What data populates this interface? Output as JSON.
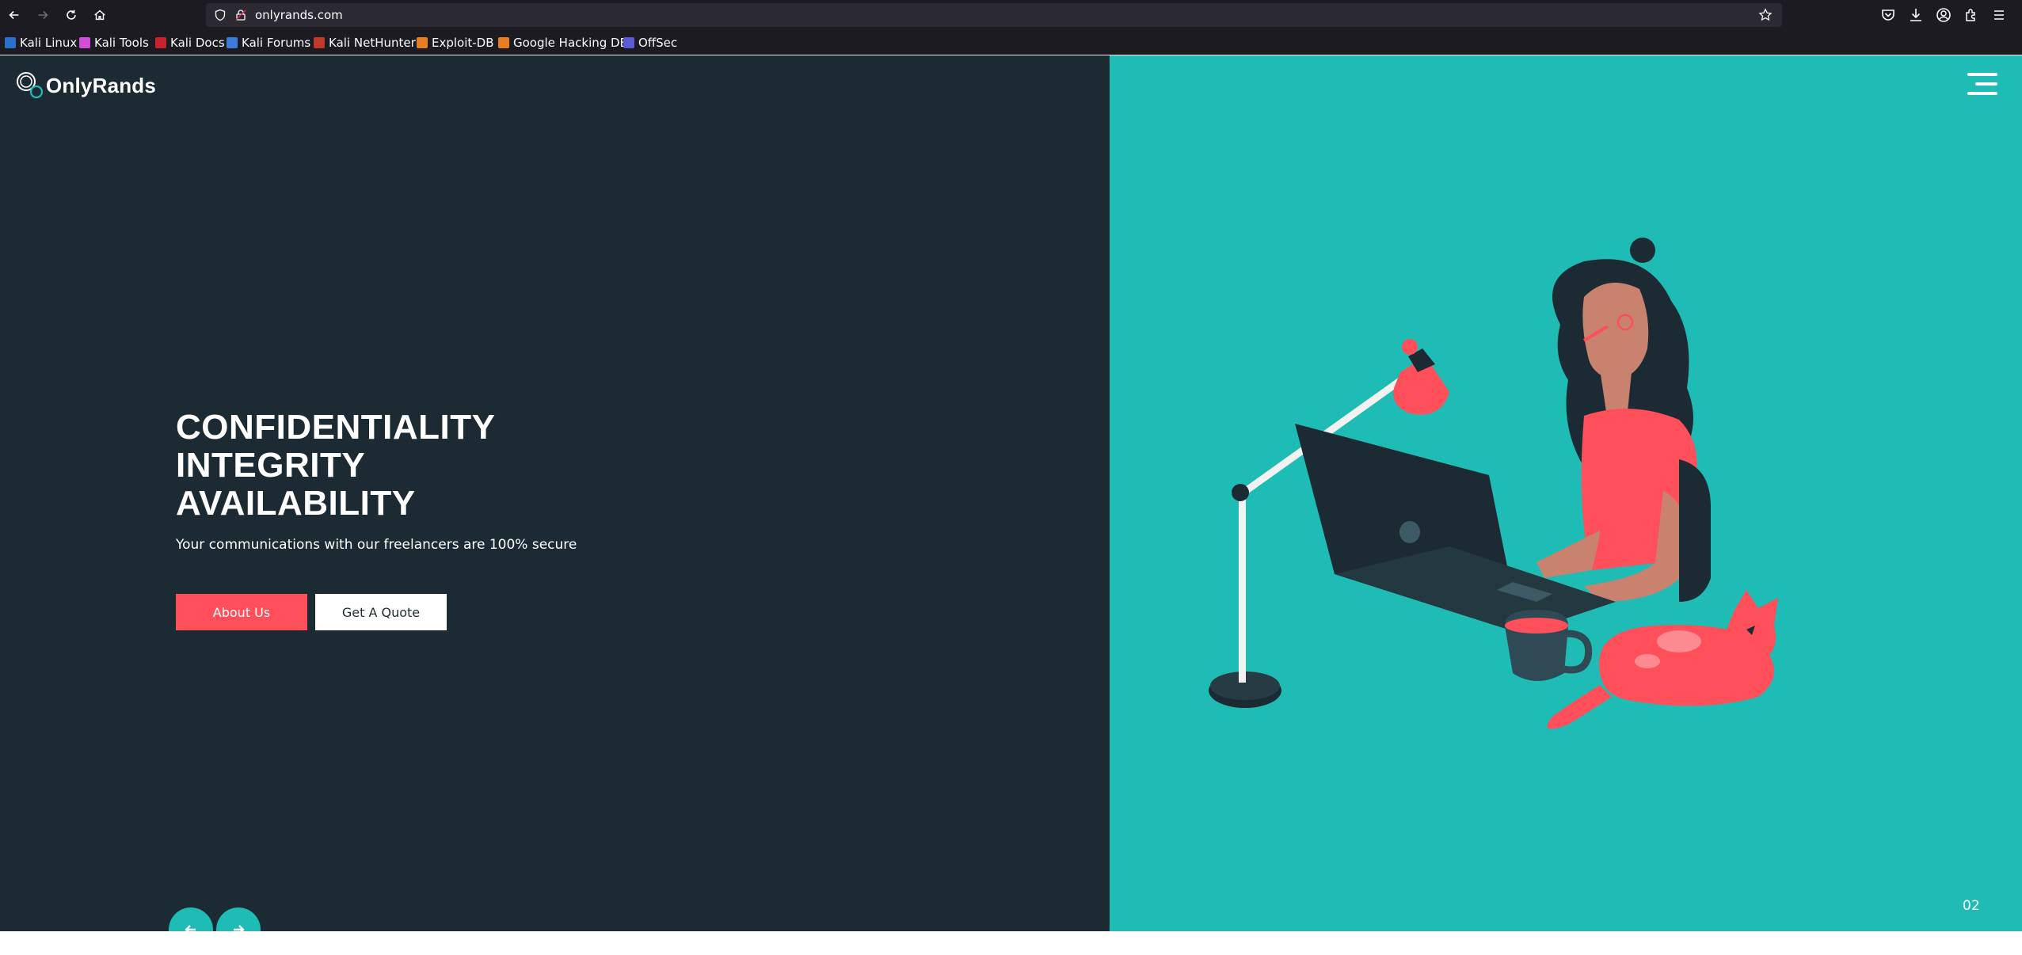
{
  "browser": {
    "url": "onlyrands.com",
    "bookmarks": [
      {
        "label": "Kali Linux",
        "icon": "kali-dragon-icon"
      },
      {
        "label": "Kali Tools",
        "icon": "kali-tools-icon"
      },
      {
        "label": "Kali Docs",
        "icon": "kali-docs-icon"
      },
      {
        "label": "Kali Forums",
        "icon": "kali-forums-icon"
      },
      {
        "label": "Kali NetHunter",
        "icon": "nethunter-icon"
      },
      {
        "label": "Exploit-DB",
        "icon": "exploit-db-icon"
      },
      {
        "label": "Google Hacking DB",
        "icon": "ghdb-icon"
      },
      {
        "label": "OffSec",
        "icon": "offsec-icon"
      }
    ]
  },
  "site": {
    "brand": "OnlyRands",
    "hero": {
      "line1": "CONFIDENTIALITY",
      "line2": "INTEGRITY",
      "line3": "AVAILABILITY",
      "subtitle": "Your communications with our freelancers are 100% secure"
    },
    "buttons": {
      "about": "About Us",
      "quote": "Get A Quote"
    },
    "slide_number": "02"
  },
  "colors": {
    "dark_panel": "#1c2b33",
    "teal": "#1ebcb4",
    "accent_red": "#fe4f5b",
    "white": "#ffffff"
  }
}
